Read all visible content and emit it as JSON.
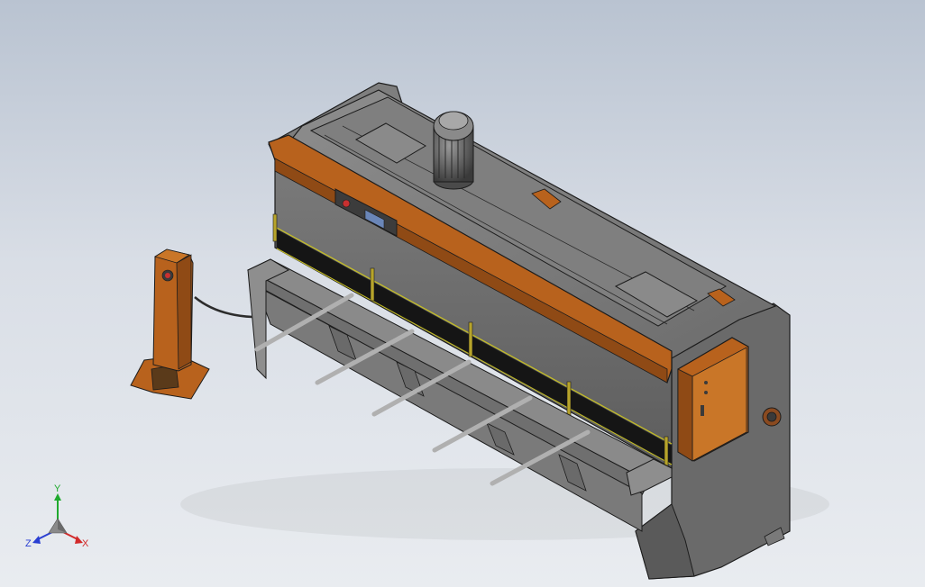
{
  "viewport": {
    "background_top": "#b9c3d1",
    "background_bottom": "#e9ecf0"
  },
  "colors": {
    "body_gray": "#6f6f6f",
    "body_dark": "#4a4a4a",
    "body_light": "#9a9a9a",
    "accent_orange": "#b8621d",
    "edge_black": "#1c1c1c",
    "blade_yellow": "#c8c020"
  },
  "triad": {
    "y_label": "Y",
    "x_label": "X",
    "z_label": "Z",
    "y_color": "#1faa2e",
    "x_color": "#d22a2a",
    "z_color": "#2a3fd2"
  }
}
